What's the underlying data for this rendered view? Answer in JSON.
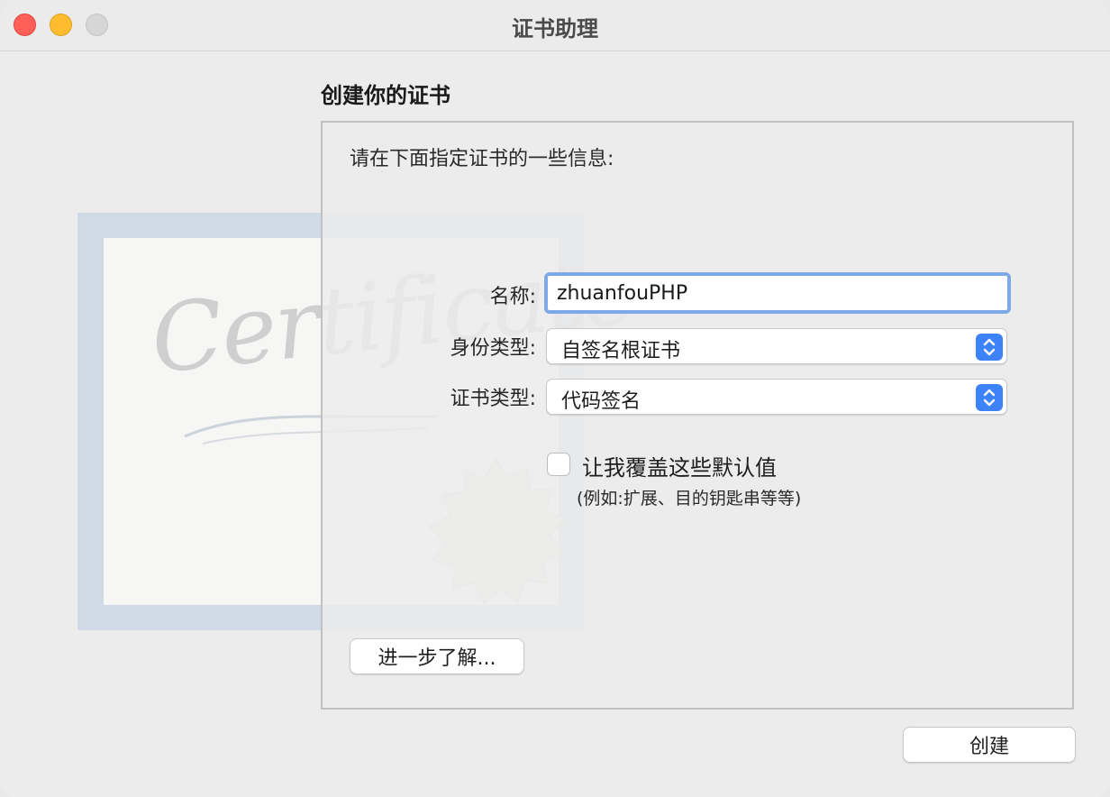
{
  "window": {
    "title": "证书助理"
  },
  "certificate_graphic": {
    "word": "Certificate"
  },
  "page": {
    "heading": "创建你的证书",
    "intro": "请在下面指定证书的一些信息:"
  },
  "form": {
    "name_label": "名称:",
    "name_value": "zhuanfouPHP",
    "identity_type_label": "身份类型:",
    "identity_type_value": "自签名根证书",
    "cert_type_label": "证书类型:",
    "cert_type_value": "代码签名",
    "override_label": "让我覆盖这些默认值",
    "override_hint": "(例如:扩展、目的钥匙串等等)",
    "override_checked": false
  },
  "buttons": {
    "learn_more": "进一步了解...",
    "create": "创建"
  },
  "colors": {
    "accent": "#3e82f7",
    "close": "#fe5f57",
    "minimize": "#febc2e",
    "zoom": "#d6d6d6"
  }
}
